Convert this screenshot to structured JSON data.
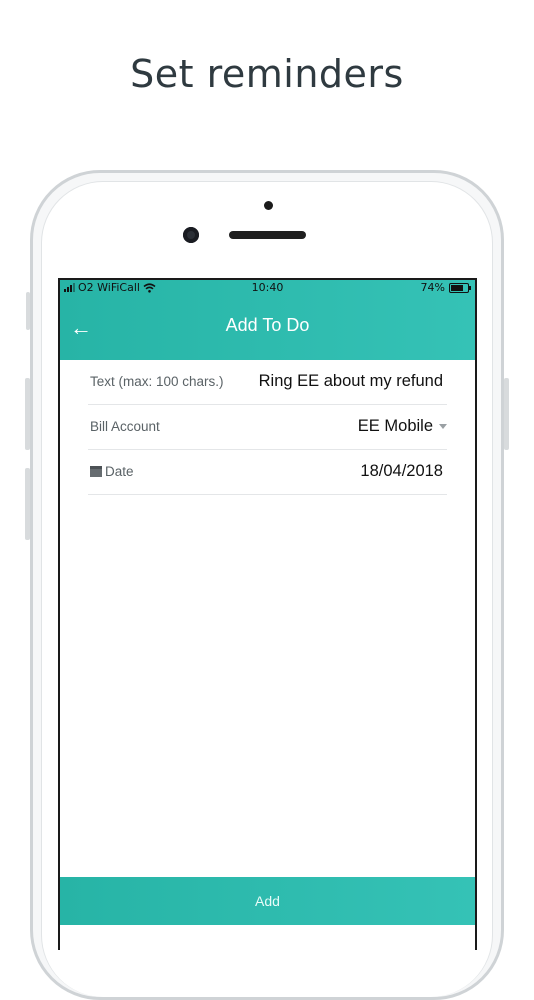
{
  "headline": "Set reminders",
  "status_bar": {
    "carrier": "O2 WiFiCall",
    "time": "10:40",
    "battery": "74%",
    "battery_level": 0.74
  },
  "appbar": {
    "back_icon": "arrow-left-icon",
    "title": "Add To Do"
  },
  "form": {
    "text_label": "Text (max: 100 chars.)",
    "text_value": "Ring EE about my refund",
    "bill_account_label": "Bill Account",
    "bill_account_value": "EE Mobile",
    "date_label": "Date",
    "date_value": "18/04/2018"
  },
  "add_button_label": "Add",
  "colors": {
    "accent": "#2fbbaf",
    "headline": "#2f3a40"
  }
}
